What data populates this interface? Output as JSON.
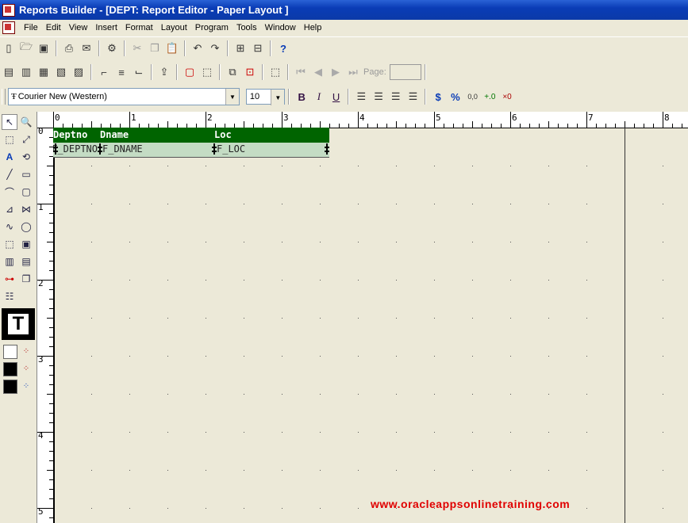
{
  "window": {
    "title": "Reports Builder - [DEPT: Report Editor - Paper Layout ]"
  },
  "menu": [
    "File",
    "Edit",
    "View",
    "Insert",
    "Format",
    "Layout",
    "Program",
    "Tools",
    "Window",
    "Help"
  ],
  "toolbar3": {
    "font": "Courier New (Western)",
    "size": "10"
  },
  "toolbar2": {
    "page_label": "Page:",
    "page_value": ""
  },
  "ruler": {
    "h_labels": [
      "0",
      "1",
      "2",
      "3",
      "4",
      "5",
      "6",
      "7",
      "8"
    ],
    "v_labels": [
      "0",
      "1",
      "2",
      "3",
      "4",
      "5"
    ]
  },
  "layout": {
    "headers": [
      "Deptno",
      "Dname",
      "Loc"
    ],
    "fields": [
      "F_DEPTNO",
      "F_DNAME",
      "F_LOC"
    ]
  },
  "watermark": "www.oracleappsonlinetraining.com",
  "colors": {
    "header_bg": "#006400",
    "field_bg": "#c4dcc4",
    "watermark": "#e00000"
  }
}
